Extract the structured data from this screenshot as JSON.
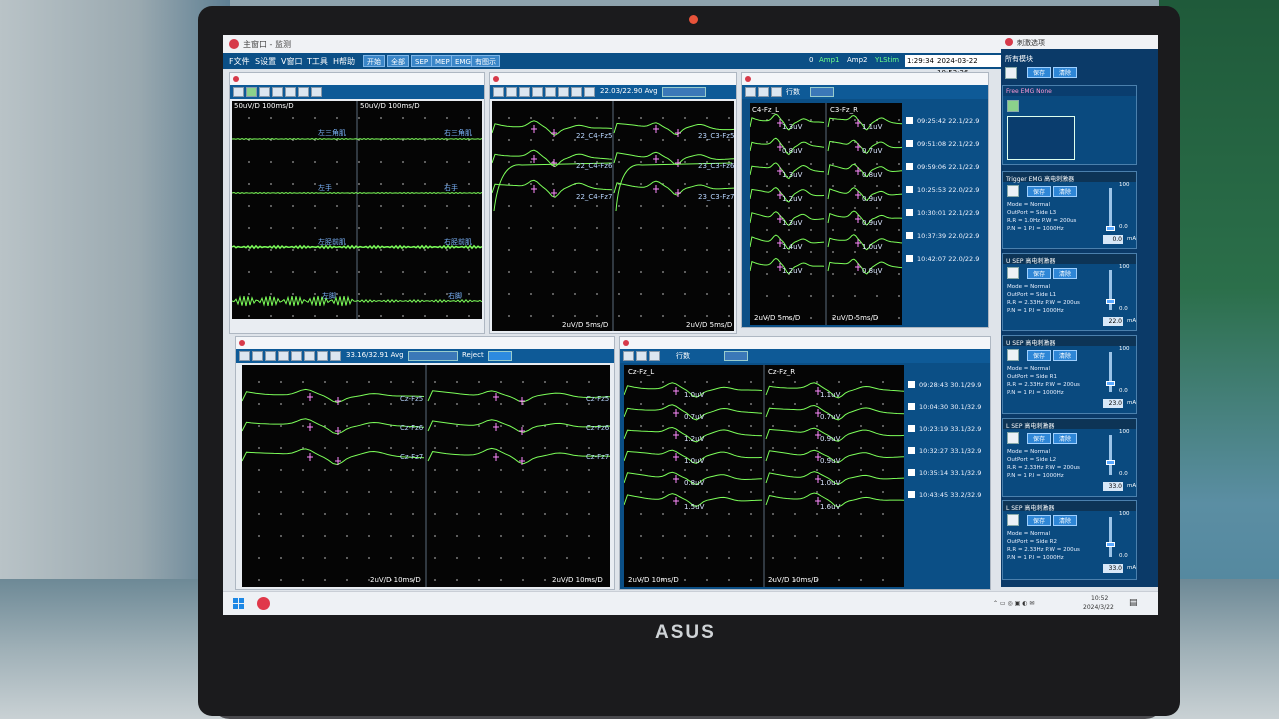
{
  "app": {
    "title": "主窗口 - 监测",
    "stim_title": "刺激选项"
  },
  "menu": [
    {
      "label": "F文件"
    },
    {
      "label": "S设置"
    },
    {
      "label": "V窗口"
    },
    {
      "label": "T工具"
    },
    {
      "label": "H帮助"
    }
  ],
  "toolbar": {
    "buttons": [
      "开始",
      "全部",
      "SEP",
      "MEP",
      "EMG",
      "有图示"
    ]
  },
  "status": {
    "chan": "0",
    "amp1": "Amp1",
    "amp2": "Amp2",
    "ylon": "YLStim",
    "elapsed": "1:29:34",
    "datetime": "2024-03-22 10:52:26"
  },
  "emg": {
    "scale_left": "50uV/D  100ms/D",
    "scale_right": "50uV/D  100ms/D",
    "channels_left": [
      "左三角肌",
      "左手",
      "左胫前肌",
      "左脚"
    ],
    "channels_right": [
      "右三角肌",
      "右手",
      "右胫前肌",
      "右脚"
    ]
  },
  "sep_top": {
    "avg": "22.03/22.90 Avg",
    "labels": [
      "22_C4-Fz5",
      "22_C4-Fz6",
      "22_C4-Fz7",
      "23_C3-Fz5",
      "23_C3-Fz6",
      "23_C3-Fz7"
    ],
    "scale_left": "2uV/D  5ms/D",
    "scale_right": "2uV/D  5ms/D"
  },
  "trend_top": {
    "title": "行数",
    "left_label": "C4-Fz_L",
    "right_label": "C3-Fz_R",
    "amps_left": [
      "1.3uV",
      "0.8uV",
      "1.3uV",
      "1.2uV",
      "1.3uV",
      "1.4uV",
      "1.2uV"
    ],
    "amps_right": [
      "1.1uV",
      "0.7uV",
      "0.8uV",
      "0.9uV",
      "0.9uV",
      "1.0uV",
      "0.8uV"
    ],
    "scale_left": "2uV/D 5ms/D",
    "scale_right": "2uV/D 5ms/D",
    "times": [
      "09:25:42 22.1/22.9",
      "09:51:08 22.1/22.9",
      "09:59:06 22.1/22.9",
      "10:25:53 22.0/22.9",
      "10:30:01 22.1/22.9",
      "10:37:39 22.0/22.9",
      "10:42:07 22.0/22.9"
    ]
  },
  "sep_bottom": {
    "avg": "33.16/32.91 Avg",
    "reject": "Reject",
    "labels": [
      "Cz-Fz5",
      "Cz-Fz6",
      "Cz-Fz7",
      "Cz-Fz5",
      "Cz-Fz6",
      "Cz-Fz7"
    ],
    "scale_left": "2uV/D  10ms/D",
    "scale_right": "2uV/D  10ms/D"
  },
  "trend_bottom": {
    "title": "行数",
    "left_label": "Cz-Fz_L",
    "right_label": "Cz-Fz_R",
    "amps_left": [
      "1.0uV",
      "0.7uV",
      "1.2uV",
      "1.0uV",
      "0.8uV",
      "1.5uV"
    ],
    "amps_right": [
      "1.1uV",
      "0.7uV",
      "0.9uV",
      "0.9uV",
      "1.0uV",
      "1.6uV"
    ],
    "scale_left": "2uV/D 10ms/D",
    "scale_right": "2uV/D 10ms/D",
    "times": [
      "09:28:43 30.1/29.9",
      "10:04:30 30.1/32.9",
      "10:23:19 33.1/32.9",
      "10:32:27 33.1/32.9",
      "10:35:14 33.1/32.9",
      "10:43:45 33.2/32.9"
    ]
  },
  "stim": {
    "header": "所有模块",
    "save": "保存",
    "clear": "清除",
    "free_emg": "Free EMG  None",
    "panels": [
      {
        "title": "Trigger EMG  高电刺激器",
        "lines": [
          "Mode = Normal",
          "OutPort = Side L3",
          "R.R = 1.0Hz  P.W = 200us",
          "P.N = 1  P.I = 1000Hz"
        ],
        "value": "0.0",
        "unit": "mA",
        "max": "100",
        "min": "0.0"
      },
      {
        "title": "U SEP  高电刺激器",
        "lines": [
          "Mode = Normal",
          "OutPort = Side L1",
          "R.R = 2.33Hz  P.W = 200us",
          "P.N = 1  P.I = 1000Hz"
        ],
        "value": "22.0",
        "unit": "mA",
        "max": "100",
        "min": "0.0"
      },
      {
        "title": "U SEP  高电刺激器",
        "lines": [
          "Mode = Normal",
          "OutPort = Side R1",
          "R.R = 2.33Hz  P.W = 200us",
          "P.N = 1  P.I = 1000Hz"
        ],
        "value": "23.0",
        "unit": "mA",
        "max": "100",
        "min": "0.0"
      },
      {
        "title": "L SEP  高电刺激器",
        "lines": [
          "Mode = Normal",
          "OutPort = Side L2",
          "R.R = 2.33Hz  P.W = 200us",
          "P.N = 1  P.I = 1000Hz"
        ],
        "value": "33.0",
        "unit": "mA",
        "max": "100",
        "min": "0.0"
      },
      {
        "title": "L SEP  高电刺激器",
        "lines": [
          "Mode = Normal",
          "OutPort = Side R2",
          "R.R = 2.33Hz  P.W = 200us",
          "P.N = 1  P.I = 1000Hz"
        ],
        "value": "33.0",
        "unit": "mA",
        "max": "100",
        "min": "0.0"
      }
    ]
  },
  "taskbar": {
    "time": "10:52",
    "date": "2024/3/22"
  },
  "laptop_brand": "ASUS",
  "colors": {
    "trace": "#7dff5a",
    "plot_bg": "#050505",
    "menubar": "#0b4f86",
    "stim_bg": "#0b3a68",
    "marker": "#ff8cff"
  }
}
